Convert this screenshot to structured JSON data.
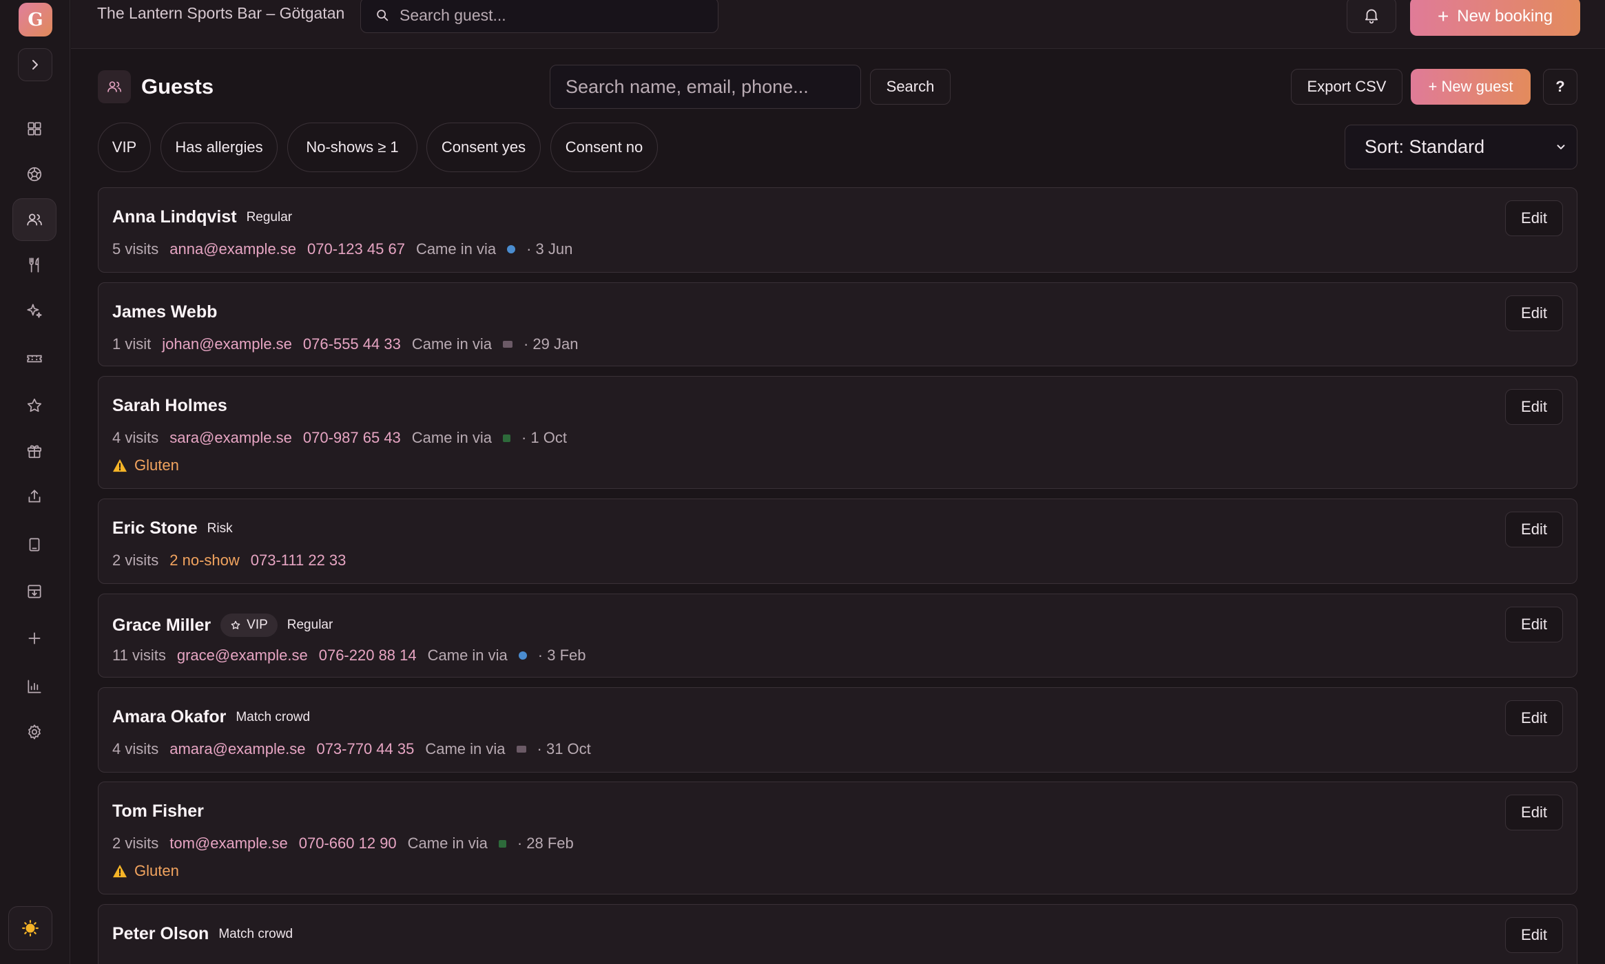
{
  "app": {
    "logo_letter": "G",
    "venue_name": "The Lantern Sports Bar – Götgatan",
    "top_search_placeholder": "Search guest...",
    "new_booking_label": "New booking",
    "new_booking_plus": "+"
  },
  "colors": {
    "accent_start": "#e07b98",
    "accent_end": "#e38b5c",
    "warning": "#f2a45f",
    "link_pink": "#e7a5c3",
    "background": "#1b1519"
  },
  "sidebar": {
    "icons": [
      "dashboard-icon",
      "football-icon",
      "users-icon",
      "cutlery-icon",
      "sparkle-icon",
      "ticket-icon",
      "star-icon",
      "gift-icon",
      "export-icon",
      "book-icon",
      "inbox-icon",
      "plus-icon",
      "chart-icon",
      "settings-icon",
      "sun-icon"
    ],
    "active": "users-icon"
  },
  "page": {
    "title": "Guests",
    "search_placeholder": "Search name, email, phone...",
    "search_button": "Search",
    "export_button": "Export CSV",
    "new_guest_button": "+ New guest",
    "help_button": "?"
  },
  "filters": [
    "VIP",
    "Has allergies",
    "No-shows ≥ 1",
    "Consent yes",
    "Consent no"
  ],
  "sort": {
    "label": "Sort: Standard"
  },
  "guests": [
    {
      "name": "Anna Lindqvist",
      "tags": [
        "Regular"
      ],
      "visits": "5 visits",
      "noshow": "",
      "email": "anna@example.se",
      "phone": "070-123 45 67",
      "via_label": "Came in via",
      "source": "web",
      "date": "· 3 Jun",
      "allergy": ""
    },
    {
      "name": "James Webb",
      "tags": [],
      "visits": "1 visit",
      "noshow": "",
      "email": "johan@example.se",
      "phone": "076-555 44 33",
      "via_label": "Came in via",
      "source": "mail",
      "date": "· 29 Jan",
      "allergy": ""
    },
    {
      "name": "Sarah Holmes",
      "tags": [],
      "visits": "4 visits",
      "noshow": "",
      "email": "sara@example.se",
      "phone": "070-987 65 43",
      "via_label": "Came in via",
      "source": "sms",
      "date": "· 1 Oct",
      "allergy": "Gluten"
    },
    {
      "name": "Eric Stone",
      "tags": [
        "Risk"
      ],
      "visits": "2 visits",
      "noshow": "2 no-show",
      "email": "",
      "phone": "073-111 22 33",
      "via_label": "",
      "source": "",
      "date": "",
      "allergy": ""
    },
    {
      "name": "Grace Miller",
      "vip": "VIP",
      "tags": [
        "Regular"
      ],
      "visits": "11 visits",
      "noshow": "",
      "email": "grace@example.se",
      "phone": "076-220 88 14",
      "via_label": "Came in via",
      "source": "web",
      "date": "· 3 Feb",
      "allergy": ""
    },
    {
      "name": "Amara Okafor",
      "tags": [
        "Match crowd"
      ],
      "visits": "4 visits",
      "noshow": "",
      "email": "amara@example.se",
      "phone": "073-770 44 35",
      "via_label": "Came in via",
      "source": "mail",
      "date": "· 31 Oct",
      "allergy": ""
    },
    {
      "name": "Tom Fisher",
      "tags": [],
      "visits": "2 visits",
      "noshow": "",
      "email": "tom@example.se",
      "phone": "070-660 12 90",
      "via_label": "Came in via",
      "source": "sms",
      "date": "· 28 Feb",
      "allergy": "Gluten"
    },
    {
      "name": "Peter Olson",
      "tags": [
        "Match crowd"
      ],
      "visits": "",
      "noshow": "",
      "email": "",
      "phone": "",
      "via_label": "",
      "source": "",
      "date": "",
      "allergy": ""
    }
  ],
  "edit_label": "Edit"
}
